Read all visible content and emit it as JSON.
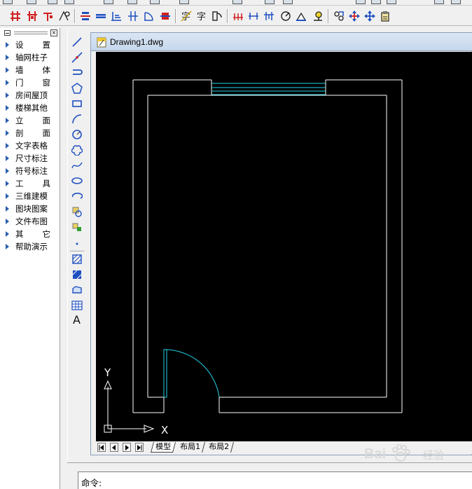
{
  "drawing_window": {
    "title": "Drawing1.dwg"
  },
  "tree_menu": {
    "items": [
      {
        "label": "设置",
        "spread": true
      },
      {
        "label": "轴网柱子",
        "spread": false
      },
      {
        "label": "墙体",
        "spread": true
      },
      {
        "label": "门窗",
        "spread": true
      },
      {
        "label": "房间屋顶",
        "spread": false
      },
      {
        "label": "楼梯其他",
        "spread": false
      },
      {
        "label": "立面",
        "spread": true
      },
      {
        "label": "剖面",
        "spread": true
      },
      {
        "label": "文字表格",
        "spread": false
      },
      {
        "label": "尺寸标注",
        "spread": false
      },
      {
        "label": "符号标注",
        "spread": false
      },
      {
        "label": "工具",
        "spread": true
      },
      {
        "label": "三维建模",
        "spread": false
      },
      {
        "label": "图块图案",
        "spread": false
      },
      {
        "label": "文件布图",
        "spread": false
      },
      {
        "label": "其它",
        "spread": true
      },
      {
        "label": "帮助演示",
        "spread": false
      }
    ]
  },
  "layout_tabs": {
    "model": "模型",
    "layout1": "布局1",
    "layout2": "布局2"
  },
  "ucs": {
    "x_label": "X",
    "y_label": "Y"
  },
  "command": {
    "label": "命令:",
    "value": ""
  },
  "watermark": {
    "brand": "Bai",
    "text": "经验"
  },
  "colors": {
    "canvas_bg": "#000000",
    "wall_lines": "#ffffff",
    "window_door_lines": "#22d3e6"
  },
  "draw_tools": [
    "line-icon",
    "construction-line-icon",
    "polyline-icon",
    "polygon-icon",
    "rectangle-icon",
    "arc-icon",
    "circle-icon",
    "revision-cloud-icon",
    "spline-icon",
    "ellipse-icon",
    "ellipse-arc-icon",
    "insert-block-icon",
    "make-block-icon",
    "point-icon",
    "hatch-icon",
    "gradient-icon",
    "region-icon",
    "table-icon",
    "mtext-icon"
  ]
}
